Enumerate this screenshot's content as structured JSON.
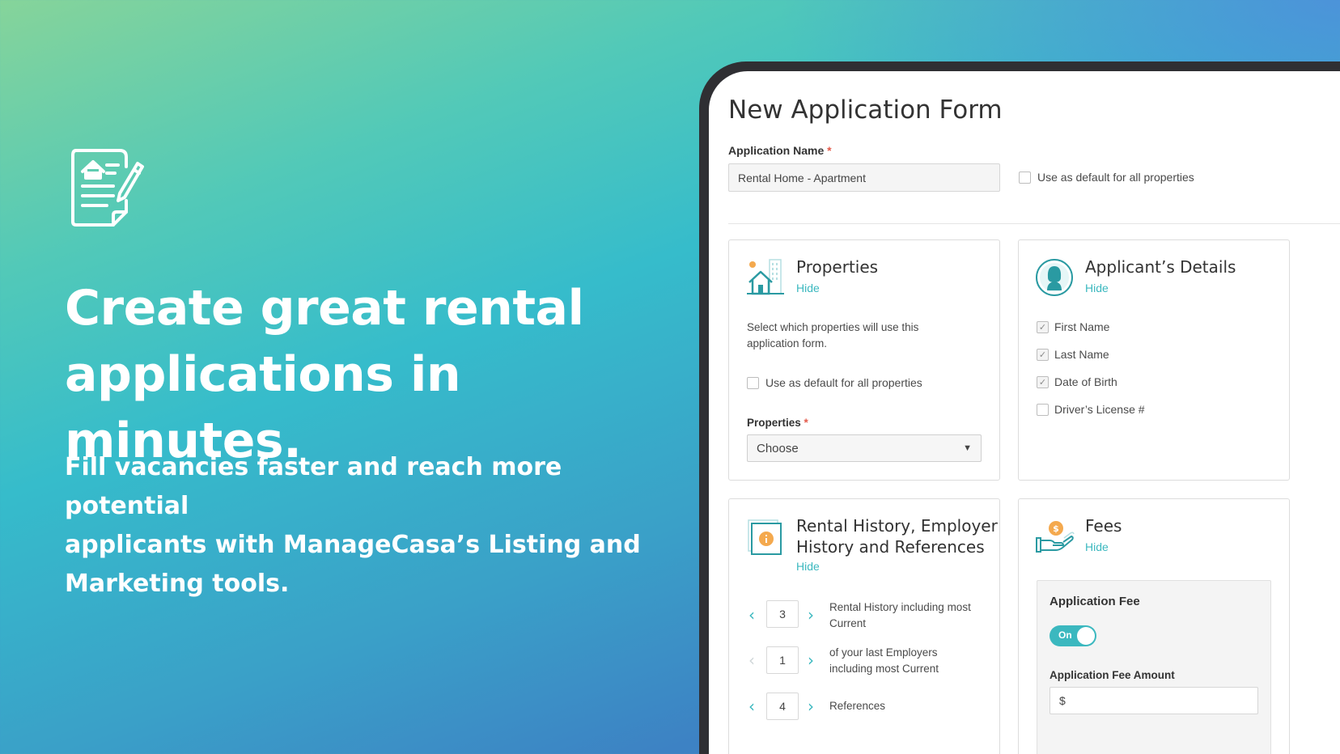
{
  "hero": {
    "headline_line1": "Create great rental",
    "headline_line2": "applications in minutes.",
    "subhead_line1": "Fill vacancies faster and reach more potential",
    "subhead_line2": "applicants with ManageCasa’s Listing and",
    "subhead_line3": "Marketing tools.",
    "icon": "document-house-pencil-icon"
  },
  "form": {
    "title": "New Application Form",
    "application_name_label": "Application Name",
    "required_mark": "*",
    "application_name_value": "Rental Home - Apartment",
    "default_all_label": "Use as default for all properties"
  },
  "properties_card": {
    "title": "Properties",
    "hide": "Hide",
    "description_line1": "Select which properties will use this",
    "description_line2": "application form.",
    "default_all_label": "Use as default for all properties",
    "properties_label": "Properties",
    "select_value": "Choose",
    "icon": "building-house-icon"
  },
  "applicant_card": {
    "title": "Applicant’s Details",
    "hide": "Hide",
    "icon": "person-avatar-icon",
    "fields": [
      {
        "label": "First Name",
        "checked": true
      },
      {
        "label": "Last Name",
        "checked": true
      },
      {
        "label": "Date of Birth",
        "checked": true
      },
      {
        "label": "Driver’s License #",
        "checked": false
      }
    ]
  },
  "history_card": {
    "title_line1": "Rental History, Employer",
    "title_line2": "History and References",
    "hide": "Hide",
    "icon": "info-document-icon",
    "steppers": [
      {
        "value": "3",
        "label_line1": "Rental History including most",
        "label_line2": "Current"
      },
      {
        "value": "1",
        "label_line1": "of your last Employers",
        "label_line2": "including most Current"
      },
      {
        "value": "4",
        "label_line1": "References",
        "label_line2": ""
      }
    ]
  },
  "fees_card": {
    "title": "Fees",
    "hide": "Hide",
    "icon": "hand-coin-icon",
    "application_fee_label": "Application Fee",
    "toggle_label": "On",
    "toggle_on": true,
    "fee_amount_label": "Application Fee Amount",
    "fee_amount_prefix": "$"
  },
  "colors": {
    "accent": "#3bb8bf",
    "required": "#e35a4a",
    "tablet_frame": "#2f2f33"
  }
}
